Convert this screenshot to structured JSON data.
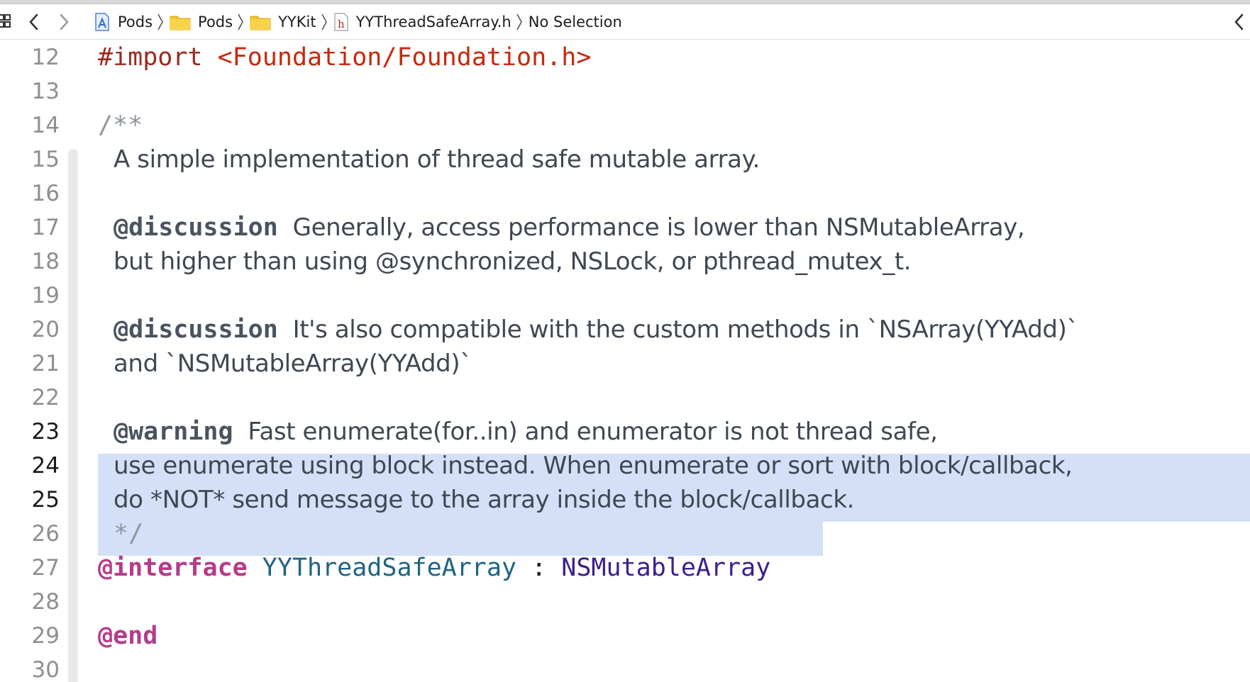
{
  "jumpbar": {
    "crumbs": [
      {
        "label": "Pods",
        "icon": "project-icon"
      },
      {
        "label": "Pods",
        "icon": "folder-icon"
      },
      {
        "label": "YYKit",
        "icon": "folder-icon"
      },
      {
        "label": "YYThreadSafeArray.h",
        "icon": "header-file-icon"
      },
      {
        "label": "No Selection",
        "icon": ""
      }
    ],
    "header_icon_letter": "h",
    "grid_glyph": "☷",
    "back_glyph": "‹",
    "forward_glyph": "›",
    "sep_glyph": "❭",
    "right_glyph": "‹"
  },
  "editor": {
    "line_numbers": [
      "12",
      "13",
      "14",
      "15",
      "16",
      "17",
      "18",
      "19",
      "20",
      "21",
      "22",
      "23",
      "24",
      "25",
      "26",
      "27",
      "28",
      "29",
      "30"
    ],
    "l12": {
      "kw": "#import",
      "path": "<Foundation/Foundation.h>"
    },
    "l14": {
      "text": "/**"
    },
    "l15": {
      "text": "A simple implementation of thread safe mutable array."
    },
    "l17": {
      "tag": "@discussion",
      "text": "Generally, access performance is lower than NSMutableArray,"
    },
    "l18": {
      "text": "but higher than using @synchronized, NSLock, or pthread_mutex_t."
    },
    "l20": {
      "tag": "@discussion",
      "text": "It's also compatible with the custom methods in `NSArray(YYAdd)`"
    },
    "l21": {
      "text": "and `NSMutableArray(YYAdd)`"
    },
    "l23": {
      "tag": "@warning",
      "text": "Fast enumerate(for..in) and enumerator is not thread safe,"
    },
    "l24": {
      "text": "use enumerate using block instead. When enumerate or sort with block/callback,"
    },
    "l25": {
      "text": "do *NOT* send message to the array inside the block/callback."
    },
    "l26": {
      "text": "*/"
    },
    "l27": {
      "kw": "@interface",
      "cls": "YYThreadSafeArray",
      "colon": ":",
      "super": "NSMutableArray"
    },
    "l29": {
      "kw": "@end"
    }
  },
  "colors": {
    "selection": "#d3e0f7",
    "keyword_pink": "#b53c8a",
    "import_red": "#9b2a1e",
    "string_red": "#c4290e",
    "class_teal": "#1f6482",
    "system_type_purple": "#3c1e8c",
    "doc_text": "#3f4752",
    "line_number": "#8e8e93"
  }
}
